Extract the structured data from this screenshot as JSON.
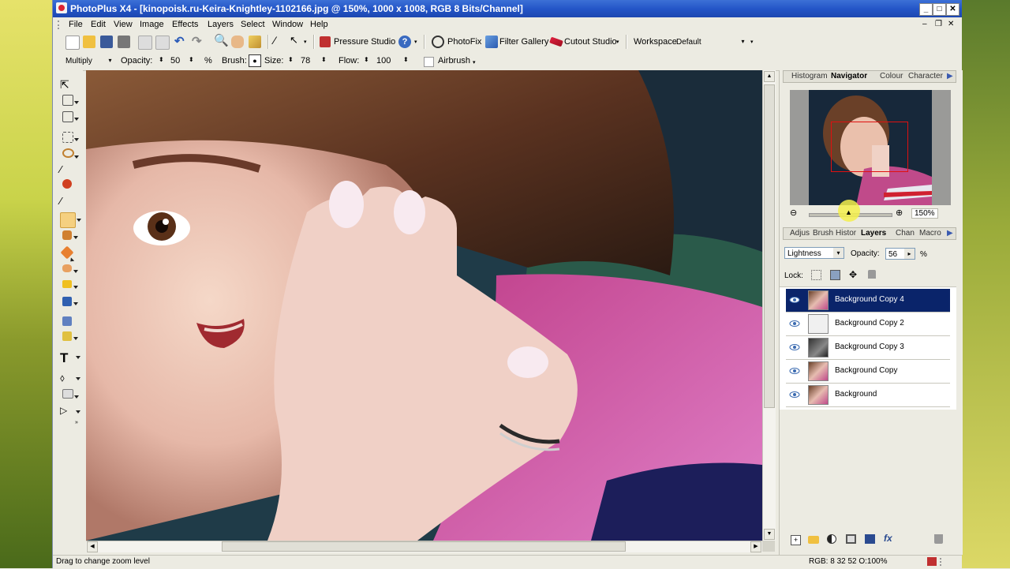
{
  "window": {
    "title": "PhotoPlus X4 - [kinopoisk.ru-Keira-Knightley-1102166.jpg @ 150%, 1000 x 1008, RGB 8 Bits/Channel]",
    "controls": [
      "minimize",
      "maximize",
      "close"
    ]
  },
  "menu": {
    "items": [
      "File",
      "Edit",
      "View",
      "Image",
      "Effects",
      "Layers",
      "Select",
      "Window",
      "Help"
    ]
  },
  "toolbar1": {
    "pressure_studio": "Pressure Studio",
    "photofix": "PhotoFix",
    "filter_gallery": "Filter Gallery",
    "cutout_studio": "Cutout Studio",
    "workspace_label": "Workspace",
    "workspace_value": "Default"
  },
  "toolbar2": {
    "blend_mode": "Multiply",
    "opacity_label": "Opacity:",
    "opacity_value": "50",
    "opacity_unit": "%",
    "brush_label": "Brush:",
    "size_label": "Size:",
    "size_value": "78",
    "flow_label": "Flow:",
    "flow_value": "100",
    "airbrush_label": "Airbrush"
  },
  "tools": [
    "move-icon",
    "crop-icon",
    "straighten-icon",
    "marquee-icon",
    "lasso-icon",
    "magic-wand-icon",
    "red-eye-icon",
    "eyedropper-icon",
    "paintbrush-icon",
    "clone-icon",
    "eraser-icon",
    "smudge-icon",
    "dodge-icon",
    "fill-icon",
    "warp-icon",
    "pen-icon",
    "text-icon",
    "shape-icon",
    "rectangle-icon",
    "node-icon"
  ],
  "navigator": {
    "tabs": [
      "Histogram",
      "Navigator",
      "Colour",
      "Character"
    ],
    "active_tab": "Navigator",
    "zoom_value": "150%"
  },
  "layers_panel": {
    "tabs": [
      "Adjus",
      "Brush",
      "Histor",
      "Layers",
      "Chan",
      "Macro"
    ],
    "active_tab": "Layers",
    "blend_mode": "Lightness",
    "opacity_label": "Opacity:",
    "opacity_value": "56",
    "opacity_unit": "%",
    "lock_label": "Lock:",
    "layers": [
      {
        "name": "Background Copy 4",
        "selected": true
      },
      {
        "name": "Background Copy 2",
        "selected": false
      },
      {
        "name": "Background Copy 3",
        "selected": false
      },
      {
        "name": "Background Copy",
        "selected": false
      },
      {
        "name": "Background",
        "selected": false
      }
    ]
  },
  "status": {
    "message": "Drag to change zoom level",
    "color_readout": "RGB: 8 32 52 O:100%"
  }
}
